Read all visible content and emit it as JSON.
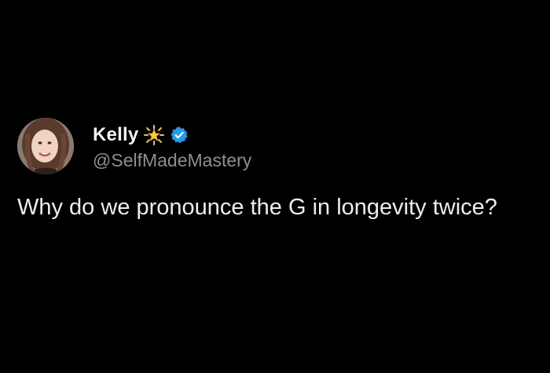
{
  "tweet": {
    "author": {
      "display_name": "Kelly",
      "handle": "@SelfMadeMastery",
      "emoji_icon": "glowing-star-icon",
      "verified": true,
      "verified_color": "#1d9bf0"
    },
    "text": "Why do we pronounce the G in longevity twice?"
  },
  "colors": {
    "background": "#000000",
    "text": "#e7e9ea",
    "secondary_text": "#8b8f94"
  }
}
